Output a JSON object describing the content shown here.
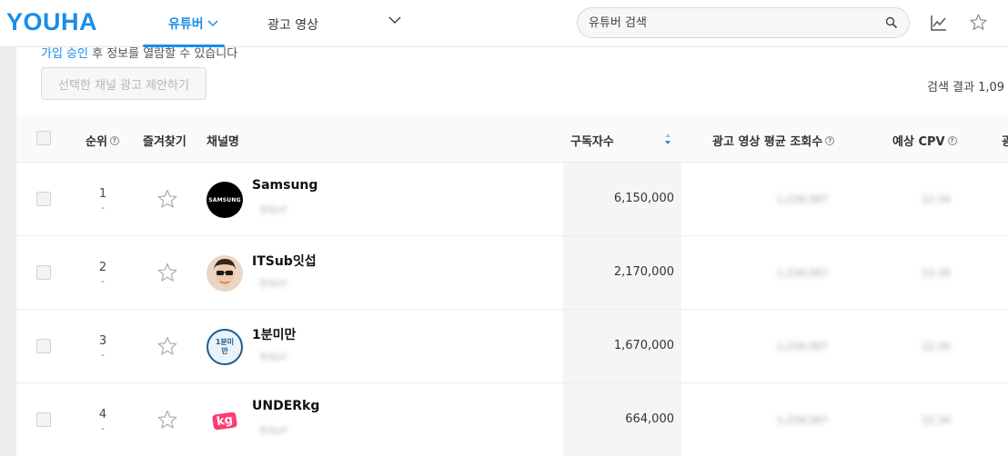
{
  "header": {
    "logo": "YOUHA",
    "nav_youtuber": "유튜버",
    "nav_ad_video": "광고 영상",
    "search_placeholder": "유튜버 검색"
  },
  "main": {
    "notice_link": "가입 승인",
    "notice_text": " 후 정보를 열람할 수 있습니다",
    "propose_button": "선택한 채널 광고 제안하기",
    "result_count": "검색 결과 1,09"
  },
  "table": {
    "columns": {
      "rank": "순위",
      "favorite": "즐겨찾기",
      "channel": "채널명",
      "subscribers": "구독자수",
      "avg_views": "광고 영상 평균 조회수",
      "cpv": "예상 CPV",
      "extra": "광"
    },
    "rows": [
      {
        "rank": "1",
        "change": "-",
        "name": "Samsung",
        "avatar_text": "SAMSUNG",
        "category": "전자/IT",
        "subscribers": "6,150,000",
        "avg_views": "1,234,567",
        "cpv": "12.34"
      },
      {
        "rank": "2",
        "change": "-",
        "name": "ITSub잇섭",
        "avatar_text": "",
        "category": "전자/IT",
        "subscribers": "2,170,000",
        "avg_views": "1,234,567",
        "cpv": "12.34"
      },
      {
        "rank": "3",
        "change": "-",
        "name": "1분미만",
        "avatar_text": "1분미만",
        "category": "전자/IT",
        "subscribers": "1,670,000",
        "avg_views": "1,234,567",
        "cpv": "12.34"
      },
      {
        "rank": "4",
        "change": "-",
        "name": "UNDERkg",
        "avatar_text": "kg",
        "category": "전자/IT",
        "subscribers": "664,000",
        "avg_views": "1,234,567",
        "cpv": "12.34"
      }
    ]
  },
  "colors": {
    "accent": "#1a8de8"
  }
}
